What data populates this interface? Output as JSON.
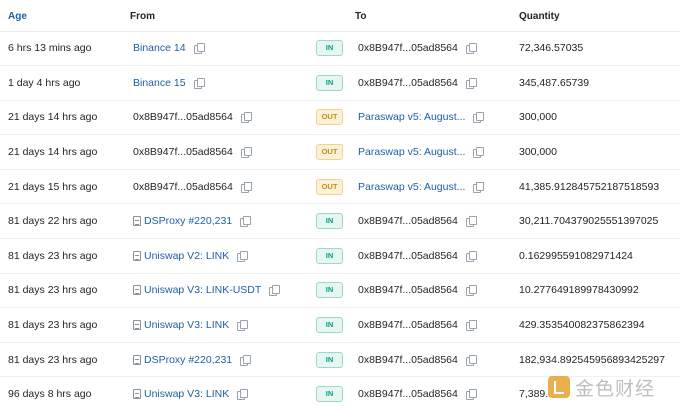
{
  "columns": {
    "age": "Age",
    "from": "From",
    "to": "To",
    "quantity": "Quantity"
  },
  "colors": {
    "link": "#1e5fa8",
    "in_badge": "#00a186",
    "out_badge": "#c58b1e"
  },
  "rows": [
    {
      "age": "6 hrs 13 mins ago",
      "from": "Binance 14",
      "from_type": "link",
      "from_icon": "",
      "direction": "IN",
      "to": "0x8B947f...05ad8564",
      "to_type": "addr",
      "quantity": "72,346.57035"
    },
    {
      "age": "1 day 4 hrs ago",
      "from": "Binance 15",
      "from_type": "link",
      "from_icon": "",
      "direction": "IN",
      "to": "0x8B947f...05ad8564",
      "to_type": "addr",
      "quantity": "345,487.65739"
    },
    {
      "age": "21 days 14 hrs ago",
      "from": "0x8B947f...05ad8564",
      "from_type": "addr",
      "from_icon": "",
      "direction": "OUT",
      "to": "Paraswap v5: August...",
      "to_type": "link",
      "quantity": "300,000"
    },
    {
      "age": "21 days 14 hrs ago",
      "from": "0x8B947f...05ad8564",
      "from_type": "addr",
      "from_icon": "",
      "direction": "OUT",
      "to": "Paraswap v5: August...",
      "to_type": "link",
      "quantity": "300,000"
    },
    {
      "age": "21 days 15 hrs ago",
      "from": "0x8B947f...05ad8564",
      "from_type": "addr",
      "from_icon": "",
      "direction": "OUT",
      "to": "Paraswap v5: August...",
      "to_type": "link",
      "quantity": "41,385.912845752187518593"
    },
    {
      "age": "81 days 22 hrs ago",
      "from": "DSProxy #220,231",
      "from_type": "link",
      "from_icon": "contract",
      "direction": "IN",
      "to": "0x8B947f...05ad8564",
      "to_type": "addr",
      "quantity": "30,211.704379025551397025"
    },
    {
      "age": "81 days 23 hrs ago",
      "from": "Uniswap V2: LINK",
      "from_type": "link",
      "from_icon": "contract",
      "direction": "IN",
      "to": "0x8B947f...05ad8564",
      "to_type": "addr",
      "quantity": "0.162995591082971424"
    },
    {
      "age": "81 days 23 hrs ago",
      "from": "Uniswap V3: LINK-USDT",
      "from_type": "link",
      "from_icon": "contract",
      "direction": "IN",
      "to": "0x8B947f...05ad8564",
      "to_type": "addr",
      "quantity": "10.277649189978430992"
    },
    {
      "age": "81 days 23 hrs ago",
      "from": "Uniswap V3: LINK",
      "from_type": "link",
      "from_icon": "contract",
      "direction": "IN",
      "to": "0x8B947f...05ad8564",
      "to_type": "addr",
      "quantity": "429.353540082375862394"
    },
    {
      "age": "81 days 23 hrs ago",
      "from": "DSProxy #220,231",
      "from_type": "link",
      "from_icon": "contract",
      "direction": "IN",
      "to": "0x8B947f...05ad8564",
      "to_type": "addr",
      "quantity": "182,934.892545956893425297"
    },
    {
      "age": "96 days 8 hrs ago",
      "from": "Uniswap V3: LINK",
      "from_type": "link",
      "from_icon": "contract",
      "direction": "IN",
      "to": "0x8B947f...05ad8564",
      "to_type": "addr",
      "quantity": "7,389."
    }
  ],
  "watermark": {
    "text": "金色财经",
    "icon": "jinse-logo-icon"
  }
}
